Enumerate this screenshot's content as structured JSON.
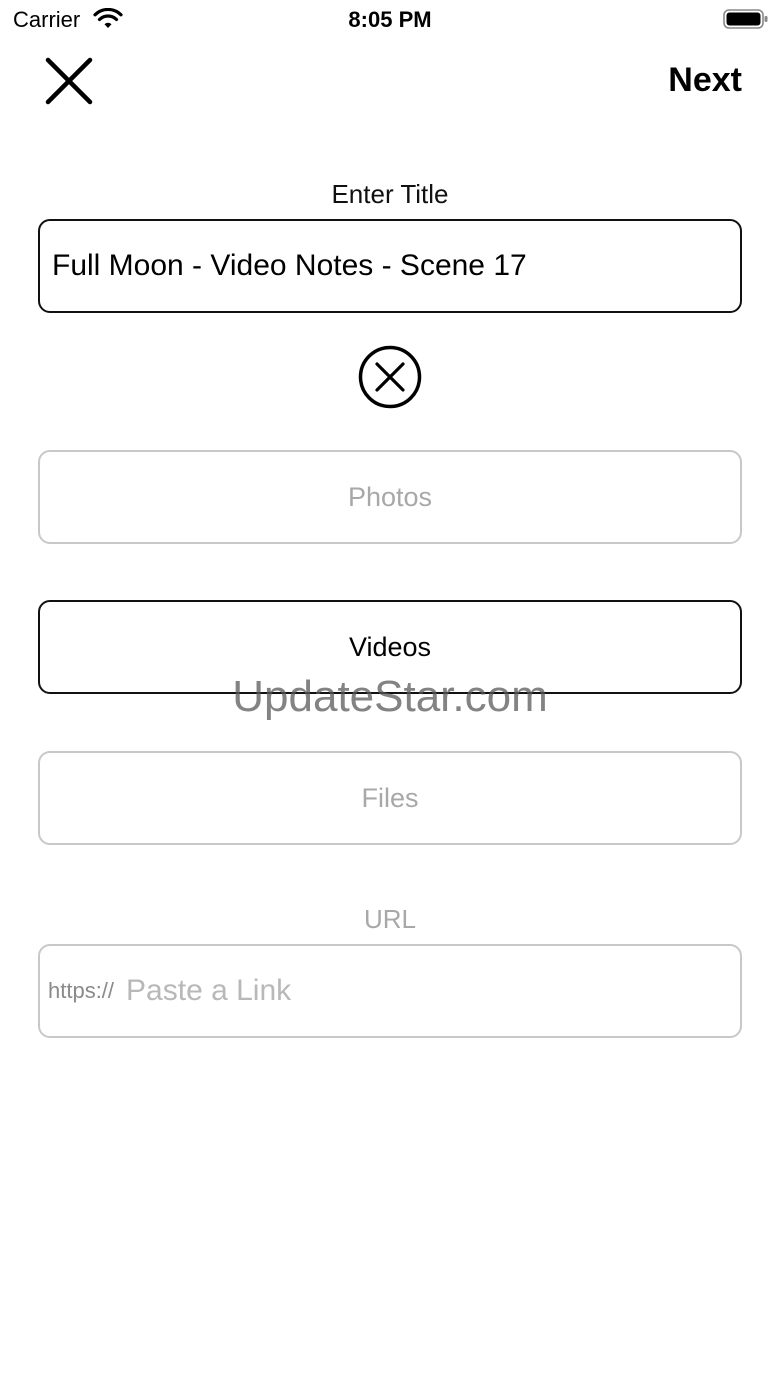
{
  "status_bar": {
    "carrier": "Carrier",
    "time": "8:05 PM",
    "icons": [
      "wifi-icon",
      "battery-icon"
    ]
  },
  "nav": {
    "close_icon": "close-icon",
    "next_label": "Next"
  },
  "title_section": {
    "label": "Enter Title",
    "value": "Full Moon - Video Notes - Scene 17",
    "clear_icon": "clear-circle-icon"
  },
  "options": {
    "photos_label": "Photos",
    "videos_label": "Videos",
    "files_label": "Files"
  },
  "url_section": {
    "label": "URL",
    "prefix": "https://",
    "placeholder": "Paste a Link"
  },
  "watermark": "UpdateStar.com",
  "colors": {
    "active_border": "#111111",
    "inactive_border": "#c8c8c8",
    "inactive_text": "#a8a8a8"
  }
}
